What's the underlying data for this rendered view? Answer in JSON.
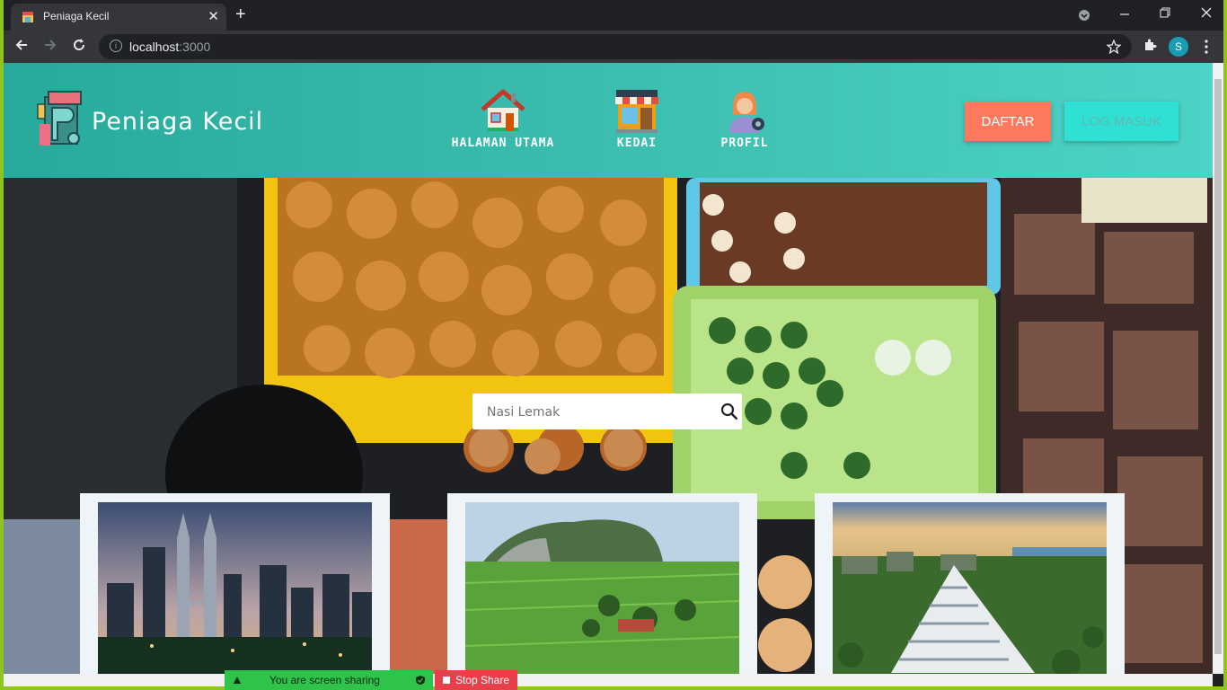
{
  "browser": {
    "tab_title": "Peniaga Kecil",
    "tab_close": "✕",
    "new_tab": "+",
    "url_host": "localhost",
    "url_port": ":3000",
    "profile_initial": "S"
  },
  "header": {
    "brand": "Peniaga Kecil",
    "nav": [
      {
        "label": "HALAMAN UTAMA",
        "icon": "house-icon"
      },
      {
        "label": "KEDAI",
        "icon": "shop-icon"
      },
      {
        "label": "PROFIL",
        "icon": "profile-icon"
      }
    ],
    "register_label": "DAFTAR",
    "login_label": "LOG MASUK"
  },
  "hero": {
    "search_placeholder": "Nasi Lemak",
    "cards": [
      {
        "alt": "Kuala Lumpur skyline"
      },
      {
        "alt": "Paddy field with limestone hill"
      },
      {
        "alt": "Conical building by the sea"
      }
    ]
  },
  "screen_share": {
    "status": "You are screen sharing",
    "stop_label": "Stop Share"
  },
  "colors": {
    "header_start": "#27a99b",
    "header_end": "#4dd3c6",
    "register_button": "#fb7a5e",
    "login_button": "#2fe0d5",
    "share_bar": "#2fc34a",
    "stop_share": "#e8404a"
  }
}
